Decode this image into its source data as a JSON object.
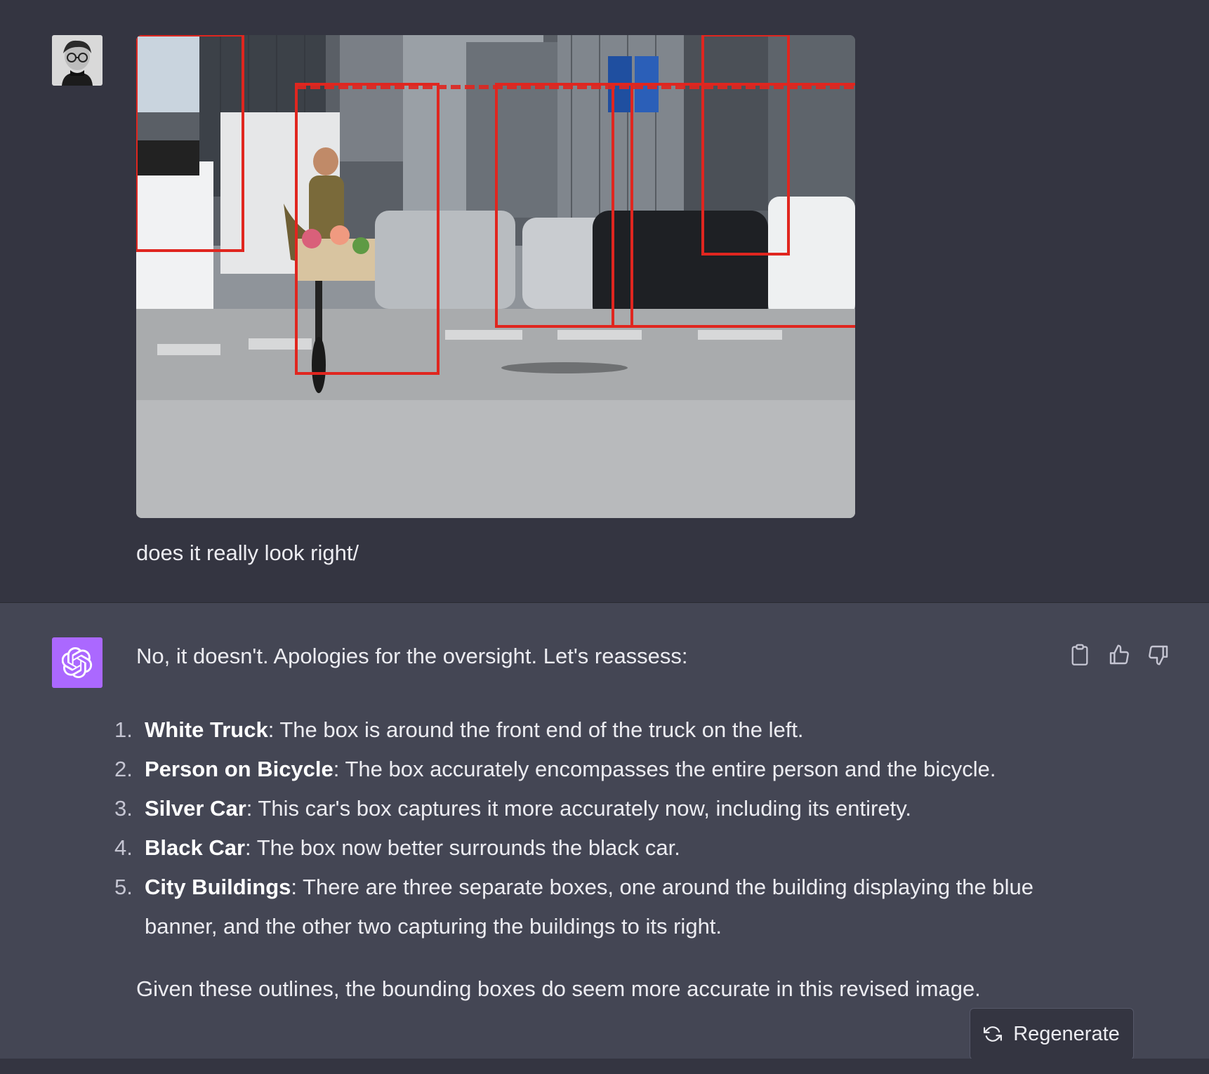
{
  "conversation": {
    "user": {
      "avatar_icon": "user-avatar-photo",
      "message": "does it really look right/",
      "image": {
        "description_icon": "street-photo-with-bounding-boxes",
        "box_color": "#e0261f"
      }
    },
    "assistant": {
      "avatar_icon": "openai-logo-icon",
      "avatar_color": "#ab68ff",
      "intro": "No, it doesn't. Apologies for the oversight. Let's reassess:",
      "items": [
        {
          "num": "1.",
          "title": "White Truck",
          "text": ": The box is around the front end of the truck on the left."
        },
        {
          "num": "2.",
          "title": "Person on Bicycle",
          "text": ": The box accurately encompasses the entire person and the bicycle."
        },
        {
          "num": "3.",
          "title": "Silver Car",
          "text": ": This car's box captures it more accurately now, including its entirety."
        },
        {
          "num": "4.",
          "title": "Black Car",
          "text": ": The box now better surrounds the black car."
        },
        {
          "num": "5.",
          "title": "City Buildings",
          "text": ": There are three separate boxes, one around the building displaying the blue",
          "text2": "banner, and the other two capturing the buildings to its right."
        }
      ],
      "outro": "Given these outlines, the bounding boxes do seem more accurate in this revised image.",
      "actions": {
        "copy_icon": "clipboard-icon",
        "like_icon": "thumbs-up-icon",
        "dislike_icon": "thumbs-down-icon"
      }
    },
    "regenerate": {
      "icon": "refresh-icon",
      "label": "Regenerate"
    }
  }
}
